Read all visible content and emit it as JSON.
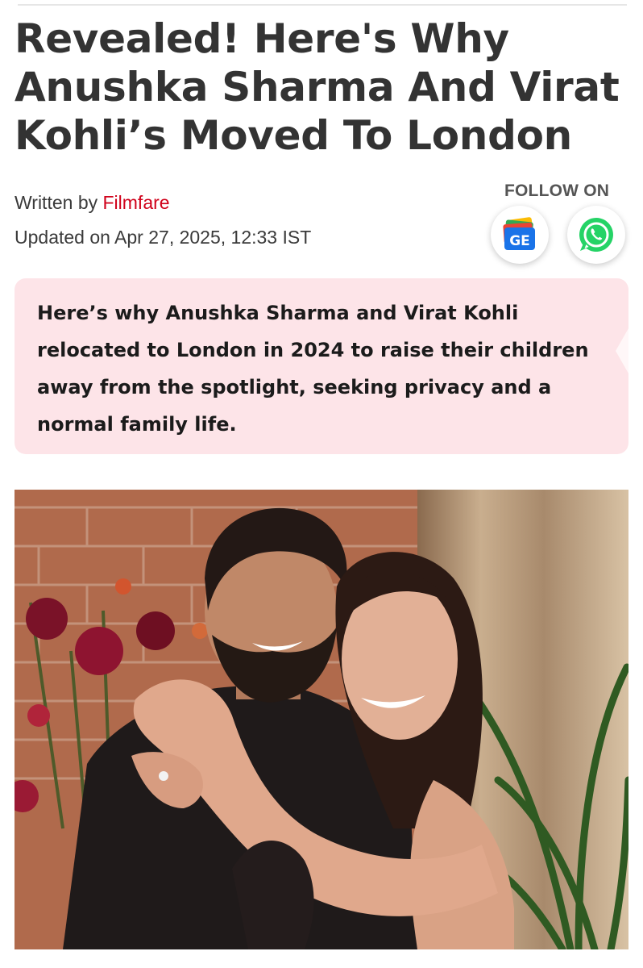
{
  "article": {
    "title": "Revealed! Here's Why Anushka Sharma And Virat Kohli’s Moved To London",
    "written_by_label": "Written by",
    "author": "Filmfare",
    "updated": "Updated on Apr 27, 2025, 12:33 IST",
    "summary": "Here’s why Anushka Sharma and Virat Kohli relocated to London in 2024 to raise their children away from the spotlight, seeking privacy and a normal family life."
  },
  "follow": {
    "label": "FOLLOW ON",
    "google_news_text": "GE",
    "icons": [
      "google-news-icon",
      "whatsapp-icon"
    ]
  },
  "colors": {
    "author": "#d0021b",
    "summary_bg": "#fde4e8",
    "whatsapp": "#25d366"
  }
}
